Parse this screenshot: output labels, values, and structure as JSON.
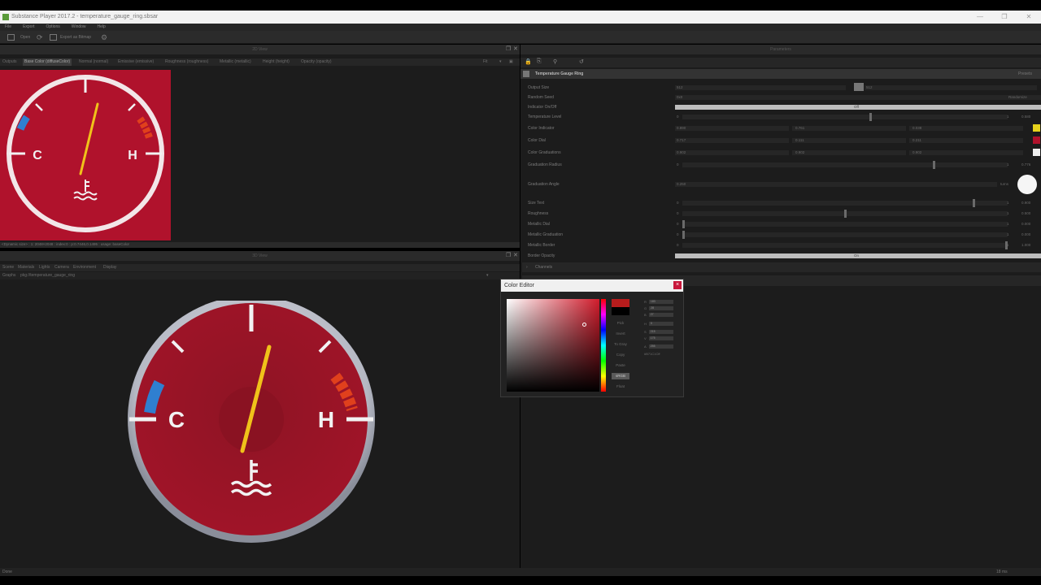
{
  "app": {
    "title": "Substance Player 2017.2 - temperature_gauge_ring.sbsar",
    "window_controls": [
      "—",
      "❐",
      "✕"
    ]
  },
  "menu": [
    "File",
    "Export",
    "Options",
    "Window",
    "Help"
  ],
  "toolbar": {
    "open_label": "Open",
    "export_label": "Export as Bitmap"
  },
  "panels": {
    "view2d_title": "2D View",
    "params_title": "Parameters",
    "view3d_title": "3D View"
  },
  "outputs": {
    "label": "Outputs",
    "tabs": [
      "Base Color (diffuseColor)",
      "Normal (normal)",
      "Emissive (emissive)",
      "Roughness (roughness)",
      "Metallic (metallic)",
      "Height (height)",
      "Opacity (opacity)"
    ],
    "zoom_label": "Fit"
  },
  "view2d_status": "<Dynamic size> : 1: 2048×2048 : index:0 : p:0.7446,0.1495 : usage: baseColor",
  "view3d": {
    "menu": [
      "Scene",
      "Materials",
      "Lights",
      "Camera",
      "Environment",
      "Display"
    ],
    "graphs_label": "Graphs",
    "graph_path": "pkg://temperature_gauge_ring"
  },
  "gauge": {
    "cold_letter": "C",
    "hot_letter": "H"
  },
  "params": {
    "graph_title": "Temperature Gauge Ring",
    "preset_label": "Presets",
    "rows": [
      {
        "label": "Output Size",
        "a": "512",
        "b": "512"
      },
      {
        "label": "Random Seed",
        "a": "0x0",
        "b": "Randomize"
      },
      {
        "label": "Indicator On/Off",
        "a": "Off"
      },
      {
        "label": "Temperature Level",
        "a": "0",
        "b": "1",
        "c": "0.580",
        "fill": 0.58
      },
      {
        "label": "Color Indicator",
        "a": "0.890",
        "b": "0.761",
        "c": "0.038"
      },
      {
        "label": "Color Dial",
        "a": "0.717",
        "b": "0.111",
        "c": "0.211"
      },
      {
        "label": "Color Graduations",
        "a": "0.902",
        "b": "0.902",
        "c": "0.902"
      },
      {
        "label": "Graduation Radius",
        "a": "0",
        "b": "1",
        "c": "0.776",
        "fill": 0.776
      },
      {
        "label": "Graduation Angle",
        "a": "0.250",
        "b": "turns"
      },
      {
        "label": "Size Text",
        "a": "0",
        "b": "1",
        "c": "0.900",
        "fill": 0.9
      },
      {
        "label": "Roughness",
        "a": "0",
        "b": "1",
        "c": "0.500",
        "fill": 0.5
      },
      {
        "label": "Metallic Dial",
        "a": "0",
        "b": "1",
        "c": "0.000",
        "fill": 0.0
      },
      {
        "label": "Metallic Graduation",
        "a": "0",
        "b": "1",
        "c": "0.000",
        "fill": 0.0
      },
      {
        "label": "Metallic Border",
        "a": "0",
        "b": "1",
        "c": "1.000",
        "fill": 1.0
      },
      {
        "label": "Border Opacity",
        "a": "On"
      }
    ],
    "channels_label": "Channels"
  },
  "color_editor": {
    "title": "Color Editor",
    "buttons": [
      "Pick",
      "Invert",
      "To Gray",
      "Copy",
      "Paste",
      "sRGB",
      "Float"
    ],
    "fields": [
      {
        "label": "R",
        "value": "183"
      },
      {
        "label": "G",
        "value": "28"
      },
      {
        "label": "B",
        "value": "27"
      },
      {
        "label": "H",
        "value": "0"
      },
      {
        "label": "S",
        "value": "215"
      },
      {
        "label": "V",
        "value": "175"
      },
      {
        "label": "A",
        "value": "255"
      }
    ],
    "hex": "#B71C1Cff"
  },
  "statusbar": {
    "left": "Done",
    "right": "18 ms"
  },
  "colors": {
    "dial_red": "#b0122c",
    "indicator_yellow": "#f0c21a",
    "cold_blue": "#2f7fd0",
    "hot_red": "#e0401c",
    "graduation_white": "#f0f0f0"
  }
}
